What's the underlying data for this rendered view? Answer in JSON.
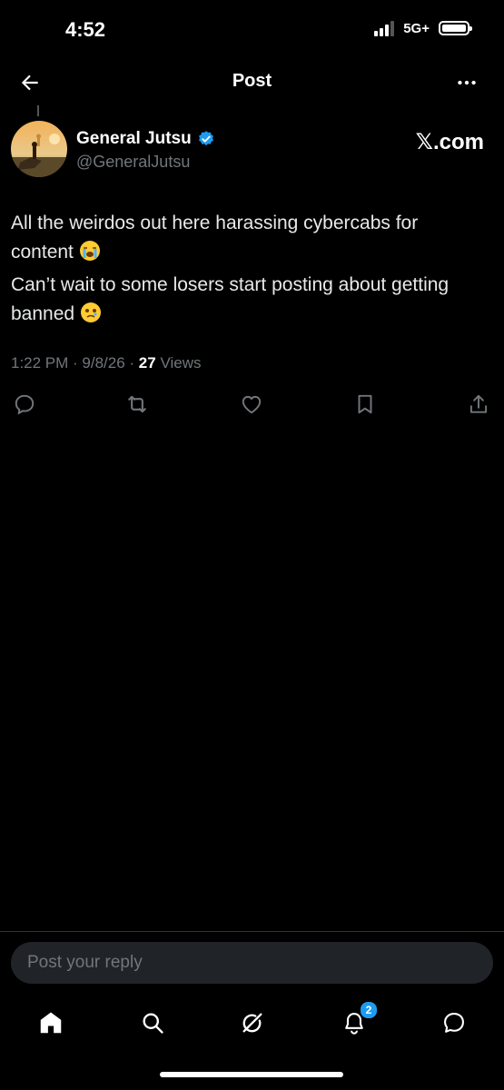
{
  "status_bar": {
    "time": "4:52",
    "network": "5G+"
  },
  "header": {
    "title": "Post",
    "back_icon": "arrow-left-icon",
    "more_icon": "more-horizontal-icon"
  },
  "author": {
    "name": "General Jutsu",
    "handle": "@GeneralJutsu",
    "verified": true,
    "verified_color": "#1d9bf0"
  },
  "source_label": "𝕏.com",
  "tweet": {
    "line1": "All the weirdos out here harassing cybercabs for content ",
    "line1_emoji": "loudly-crying-face",
    "line2": "Can’t wait to some losers start posting about getting banned ",
    "line2_emoji": "face-holding-back-tears"
  },
  "meta": {
    "time": "1:22 PM",
    "date": "9/8/26",
    "views_count": "27",
    "views_label": "Views"
  },
  "actions": [
    "reply-icon",
    "retweet-icon",
    "like-icon",
    "bookmark-icon",
    "share-icon"
  ],
  "reply": {
    "placeholder": "Post your reply"
  },
  "tabbar": {
    "notifications_badge": "2",
    "items": [
      "home-icon",
      "search-icon",
      "grok-icon",
      "notifications-icon",
      "messages-icon"
    ]
  },
  "colors": {
    "background": "#000000",
    "accent": "#1d9bf0",
    "secondary_text": "#71767b"
  }
}
